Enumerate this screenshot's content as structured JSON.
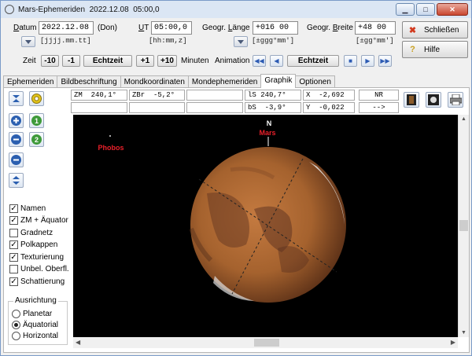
{
  "window": {
    "title_app": "Mars-Ephemeriden",
    "title_date": "2022.12.08",
    "title_time": "05:00,0"
  },
  "date": {
    "label_u": "D",
    "label_rest": "atum",
    "value": "2022.12.08",
    "weekday": "(Don)",
    "format": "[jjjj.mm.tt]"
  },
  "ut": {
    "label_u": "U",
    "label_rest": "T",
    "value": "05:00,0",
    "format": "[hh:mm,z]"
  },
  "longitude": {
    "label_pre": "Geogr. ",
    "label_u": "L",
    "label_rest": "änge",
    "value": "+016 00",
    "format": "[±ggg°mm']"
  },
  "latitude": {
    "label_pre": "Geogr. ",
    "label_u": "B",
    "label_rest": "reite",
    "value": "+48 00",
    "format": "[±gg°mm']"
  },
  "buttons": {
    "close": "Schließen",
    "help": "Hilfe"
  },
  "zeit": {
    "label": "Zeit",
    "minus10": "-10",
    "minus1": "-1",
    "echtzeit": "Echtzeit",
    "plus1": "+1",
    "plus10": "+10",
    "minuten": "Minuten"
  },
  "animation": {
    "label": "Animation",
    "echtzeit": "Echtzeit"
  },
  "tabs": [
    "Ephemeriden",
    "Bildbeschriftung",
    "Mondkoordinaten",
    "Mondephemeriden",
    "Graphik",
    "Optionen"
  ],
  "cells": {
    "zm": "ZM  240,1°",
    "zbr": "ZBr  -5,2°",
    "ls": "lS 240,7°",
    "x": "X  -2,692",
    "nr": "NR",
    "bs": "bS  -3,9°",
    "y": "Y  -0,022",
    "arrow": "-->"
  },
  "checkboxes": [
    {
      "label": "Namen",
      "checked": true
    },
    {
      "label": "ZM + Äquator",
      "checked": true
    },
    {
      "label": "Gradnetz",
      "checked": false
    },
    {
      "label": "Polkappen",
      "checked": true
    },
    {
      "label": "Texturierung",
      "checked": true
    },
    {
      "label": "Unbel. Oberfl.",
      "checked": false
    },
    {
      "label": "Schattierung",
      "checked": true
    }
  ],
  "orientation": {
    "title": "Ausrichtung",
    "options": [
      "Planetar",
      "Äquatorial",
      "Horizontal"
    ],
    "selected": 1
  },
  "graphic": {
    "north": "N",
    "planet": "Mars",
    "moon": "Phobos"
  },
  "colors": {
    "label_red": "#e8202a",
    "planet": "#b06a35"
  }
}
